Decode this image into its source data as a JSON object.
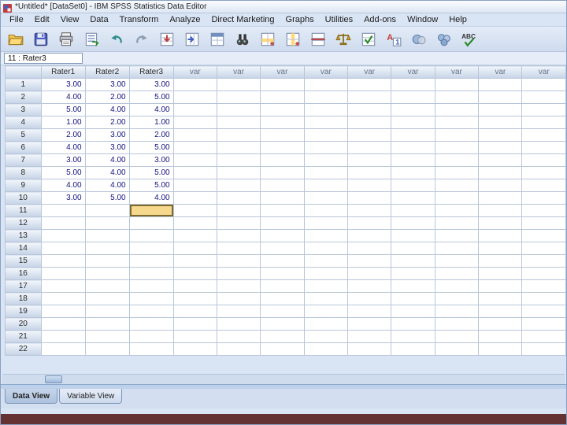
{
  "window": {
    "title": "*Untitled* [DataSet0] -  IBM SPSS Statistics Data Editor"
  },
  "menu": {
    "items": [
      "File",
      "Edit",
      "View",
      "Data",
      "Transform",
      "Analyze",
      "Direct Marketing",
      "Graphs",
      "Utilities",
      "Add-ons",
      "Window",
      "Help"
    ]
  },
  "toolbar": {
    "buttons": [
      "open-data",
      "save",
      "print",
      "recall-dialogs",
      "undo",
      "redo",
      "goto-case",
      "goto-variable",
      "variables",
      "find",
      "insert-cases",
      "insert-variable",
      "split-file",
      "weight-cases",
      "select-cases",
      "value-labels",
      "use-variable-sets",
      "show-all-variables",
      "spell-check"
    ]
  },
  "cell_ref": {
    "value": "11 : Rater3"
  },
  "grid": {
    "columns": [
      "Rater1",
      "Rater2",
      "Rater3",
      "var",
      "var",
      "var",
      "var",
      "var",
      "var",
      "var",
      "var",
      "var"
    ],
    "rows": [
      {
        "n": "1",
        "values": [
          "3.00",
          "3.00",
          "3.00"
        ]
      },
      {
        "n": "2",
        "values": [
          "4.00",
          "2.00",
          "5.00"
        ]
      },
      {
        "n": "3",
        "values": [
          "5.00",
          "4.00",
          "4.00"
        ]
      },
      {
        "n": "4",
        "values": [
          "1.00",
          "2.00",
          "1.00"
        ]
      },
      {
        "n": "5",
        "values": [
          "2.00",
          "3.00",
          "2.00"
        ]
      },
      {
        "n": "6",
        "values": [
          "4.00",
          "3.00",
          "5.00"
        ]
      },
      {
        "n": "7",
        "values": [
          "3.00",
          "4.00",
          "3.00"
        ]
      },
      {
        "n": "8",
        "values": [
          "5.00",
          "4.00",
          "5.00"
        ]
      },
      {
        "n": "9",
        "values": [
          "4.00",
          "4.00",
          "5.00"
        ]
      },
      {
        "n": "10",
        "values": [
          "3.00",
          "5.00",
          "4.00"
        ]
      },
      {
        "n": "11",
        "values": []
      },
      {
        "n": "12",
        "values": []
      },
      {
        "n": "13",
        "values": []
      },
      {
        "n": "14",
        "values": []
      },
      {
        "n": "15",
        "values": []
      },
      {
        "n": "16",
        "values": []
      },
      {
        "n": "17",
        "values": []
      },
      {
        "n": "18",
        "values": []
      },
      {
        "n": "19",
        "values": []
      },
      {
        "n": "20",
        "values": []
      },
      {
        "n": "21",
        "values": []
      },
      {
        "n": "22",
        "values": []
      }
    ],
    "selected": {
      "row": "11",
      "col_index": 2
    }
  },
  "tabs": {
    "data_view": "Data View",
    "variable_view": "Variable View"
  },
  "colors": {
    "selection_fill": "#f7d98e",
    "selection_border": "#7c6a2d",
    "value_text": "#14147d",
    "band_bottom": "#643232"
  }
}
